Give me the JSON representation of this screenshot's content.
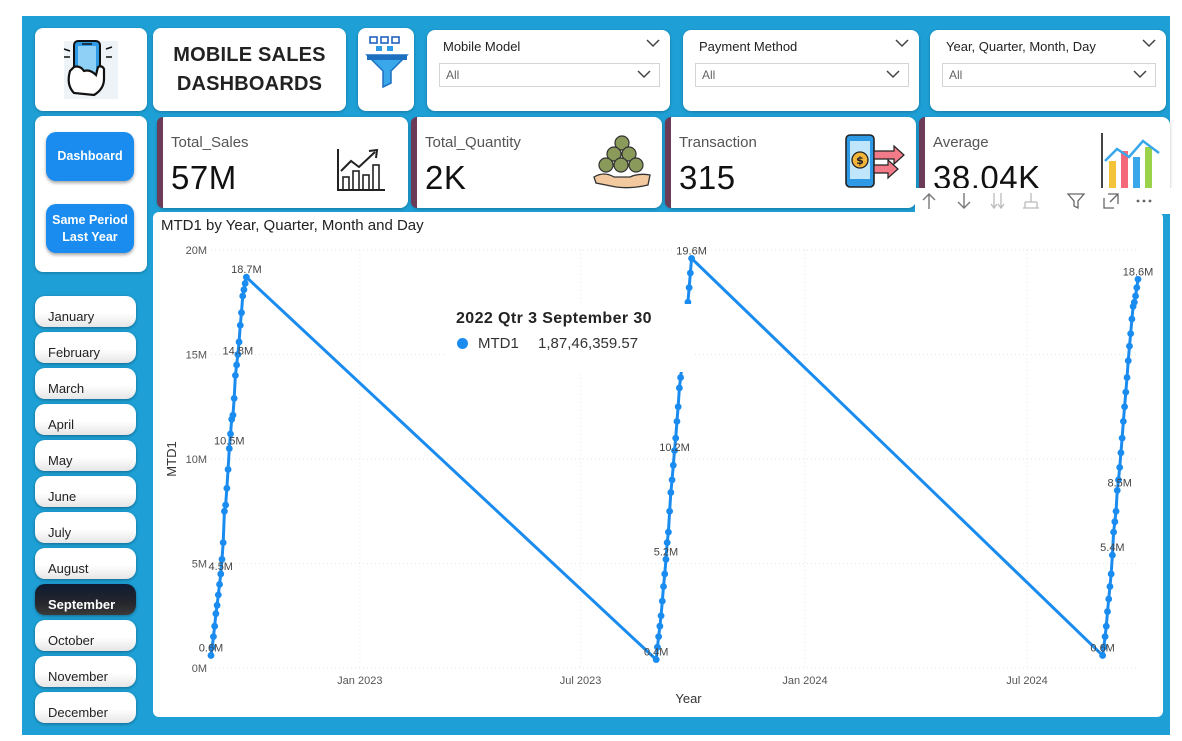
{
  "header": {
    "title": "MOBILE SALES\nDASHBOARDS",
    "logo_icon": "phone-in-hand-icon",
    "filter_icon": "funnel-icon"
  },
  "slicers": [
    {
      "label": "Mobile Model",
      "value": "All"
    },
    {
      "label": "Payment Method",
      "value": "All"
    },
    {
      "label": "Year, Quarter, Month, Day",
      "value": "All"
    }
  ],
  "nav": {
    "dashboard": "Dashboard",
    "same_period": "Same Period\nLast Year"
  },
  "months": [
    "January",
    "February",
    "March",
    "April",
    "May",
    "June",
    "July",
    "August",
    "September",
    "October",
    "November",
    "December"
  ],
  "selected_month": "September",
  "kpis": [
    {
      "label": "Total_Sales",
      "value": "57M",
      "icon": "bar-chart-growth-icon"
    },
    {
      "label": "Total_Quantity",
      "value": "2K",
      "icon": "coins-in-hand-icon"
    },
    {
      "label": "Transaction",
      "value": "315",
      "icon": "mobile-payment-icon"
    },
    {
      "label": "Average",
      "value": "38.04K",
      "icon": "trend-chart-icon"
    }
  ],
  "toolbar": [
    "arrow-up-icon",
    "arrow-down-icon",
    "double-arrow-down-icon",
    "expand-hierarchy-icon",
    "filter-icon",
    "focus-mode-icon",
    "more-options-icon"
  ],
  "tooltip": {
    "title": "2022 Qtr 3 September 30",
    "series": "MTD1",
    "value": "1,87,46,359.57"
  },
  "chart_data": {
    "type": "line",
    "title": "MTD1 by Year, Quarter, Month and Day",
    "xlabel": "Year",
    "ylabel": "MTD1",
    "ylim": [
      0,
      20
    ],
    "y_unit": "M",
    "y_ticks": [
      "0M",
      "5M",
      "10M",
      "15M",
      "20M"
    ],
    "x_ticks": [
      "Jan 2023",
      "Jul 2023",
      "Jan 2024",
      "Jul 2024"
    ],
    "x_range": [
      "2022-09-01",
      "2024-09-30"
    ],
    "accent": "#1a8cf0",
    "series": [
      {
        "name": "MTD1",
        "points": [
          [
            "2022-09-01",
            0.6
          ],
          [
            "2022-09-02",
            1.0
          ],
          [
            "2022-09-03",
            1.5
          ],
          [
            "2022-09-04",
            2.0
          ],
          [
            "2022-09-05",
            2.6
          ],
          [
            "2022-09-06",
            3.0
          ],
          [
            "2022-09-07",
            3.5
          ],
          [
            "2022-09-08",
            4.0
          ],
          [
            "2022-09-09",
            4.5
          ],
          [
            "2022-09-10",
            5.2
          ],
          [
            "2022-09-11",
            6.0
          ],
          [
            "2022-09-12",
            7.5
          ],
          [
            "2022-09-13",
            7.8
          ],
          [
            "2022-09-14",
            8.6
          ],
          [
            "2022-09-15",
            9.5
          ],
          [
            "2022-09-16",
            10.5
          ],
          [
            "2022-09-17",
            11.2
          ],
          [
            "2022-09-18",
            11.9
          ],
          [
            "2022-09-19",
            12.1
          ],
          [
            "2022-09-20",
            12.9
          ],
          [
            "2022-09-21",
            14.0
          ],
          [
            "2022-09-22",
            14.5
          ],
          [
            "2022-09-23",
            15.0
          ],
          [
            "2022-09-24",
            15.6
          ],
          [
            "2022-09-25",
            16.4
          ],
          [
            "2022-09-26",
            17.0
          ],
          [
            "2022-09-27",
            17.8
          ],
          [
            "2022-09-28",
            18.1
          ],
          [
            "2022-09-29",
            18.4
          ],
          [
            "2022-09-30",
            18.7
          ],
          [
            "2023-09-01",
            0.4
          ],
          [
            "2023-09-02",
            1.0
          ],
          [
            "2023-09-03",
            1.5
          ],
          [
            "2023-09-04",
            2.0
          ],
          [
            "2023-09-05",
            2.5
          ],
          [
            "2023-09-06",
            3.2
          ],
          [
            "2023-09-07",
            3.9
          ],
          [
            "2023-09-08",
            4.5
          ],
          [
            "2023-09-09",
            5.2
          ],
          [
            "2023-09-10",
            6.0
          ],
          [
            "2023-09-11",
            6.5
          ],
          [
            "2023-09-12",
            7.5
          ],
          [
            "2023-09-13",
            8.4
          ],
          [
            "2023-09-14",
            9.0
          ],
          [
            "2023-09-15",
            9.7
          ],
          [
            "2023-09-16",
            10.4
          ],
          [
            "2023-09-17",
            11.0
          ],
          [
            "2023-09-18",
            11.8
          ],
          [
            "2023-09-19",
            12.5
          ],
          [
            "2023-09-20",
            13.4
          ],
          [
            "2023-09-21",
            13.9
          ],
          [
            "2023-09-22",
            14.4
          ],
          [
            "2023-09-23",
            15.0
          ],
          [
            "2023-09-24",
            15.4
          ],
          [
            "2023-09-25",
            16.0
          ],
          [
            "2023-09-26",
            16.9
          ],
          [
            "2023-09-27",
            17.5
          ],
          [
            "2023-09-28",
            18.2
          ],
          [
            "2023-09-29",
            18.9
          ],
          [
            "2023-09-30",
            19.6
          ],
          [
            "2024-09-01",
            0.6
          ],
          [
            "2024-09-02",
            1.0
          ],
          [
            "2024-09-03",
            1.5
          ],
          [
            "2024-09-04",
            2.0
          ],
          [
            "2024-09-05",
            2.7
          ],
          [
            "2024-09-06",
            3.3
          ],
          [
            "2024-09-07",
            3.9
          ],
          [
            "2024-09-08",
            4.5
          ],
          [
            "2024-09-09",
            5.4
          ],
          [
            "2024-09-10",
            6.5
          ],
          [
            "2024-09-11",
            7.0
          ],
          [
            "2024-09-12",
            7.5
          ],
          [
            "2024-09-13",
            8.5
          ],
          [
            "2024-09-14",
            9.0
          ],
          [
            "2024-09-15",
            9.6
          ],
          [
            "2024-09-16",
            10.3
          ],
          [
            "2024-09-17",
            11.0
          ],
          [
            "2024-09-18",
            11.8
          ],
          [
            "2024-09-19",
            12.5
          ],
          [
            "2024-09-20",
            13.2
          ],
          [
            "2024-09-21",
            13.9
          ],
          [
            "2024-09-22",
            14.7
          ],
          [
            "2024-09-23",
            15.4
          ],
          [
            "2024-09-24",
            16.0
          ],
          [
            "2024-09-25",
            16.7
          ],
          [
            "2024-09-26",
            17.3
          ],
          [
            "2024-09-27",
            17.5
          ],
          [
            "2024-09-28",
            17.8
          ],
          [
            "2024-09-29",
            18.2
          ],
          [
            "2024-09-30",
            18.6
          ]
        ]
      }
    ],
    "data_labels": [
      [
        "2022-09-01",
        0.6,
        "0.6M"
      ],
      [
        "2022-09-09",
        4.5,
        "4.5M"
      ],
      [
        "2022-09-16",
        10.5,
        "10.5M"
      ],
      [
        "2022-09-23",
        14.8,
        "14.8M"
      ],
      [
        "2022-09-30",
        18.7,
        "18.7M"
      ],
      [
        "2023-09-01",
        0.4,
        "0.4M"
      ],
      [
        "2023-09-09",
        5.2,
        "5.2M"
      ],
      [
        "2023-09-16",
        10.2,
        "10.2M"
      ],
      [
        "2023-09-30",
        19.6,
        "19.6M"
      ],
      [
        "2024-09-01",
        0.6,
        "0.6M"
      ],
      [
        "2024-09-09",
        5.4,
        "5.4M"
      ],
      [
        "2024-09-15",
        8.5,
        "8.5M"
      ],
      [
        "2024-09-30",
        18.6,
        "18.6M"
      ]
    ]
  }
}
